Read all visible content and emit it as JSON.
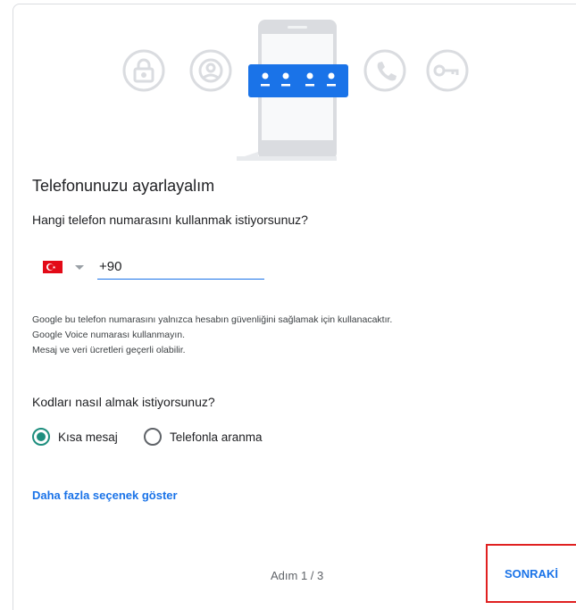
{
  "header": {
    "title": "Telefonunuzu ayarlayalım",
    "question": "Hangi telefon numarasını kullanmak istiyorsunuz?",
    "icons": [
      "lock-icon",
      "account-icon",
      "password-dots-icon",
      "phone-call-icon",
      "key-icon"
    ]
  },
  "phone": {
    "country": "TR",
    "value": "+90"
  },
  "notes": {
    "line1": "Google bu telefon numarasını yalnızca hesabın güvenliğini sağlamak için kullanacaktır.",
    "line2": "Google Voice numarası kullanmayın.",
    "line3": "Mesaj ve veri ücretleri geçerli olabilir."
  },
  "codes": {
    "question": "Kodları nasıl almak istiyorsunuz?",
    "option_sms": "Kısa mesaj",
    "option_call": "Telefonla aranma",
    "selected": "sms"
  },
  "more_options": "Daha fazla seçenek göster",
  "footer": {
    "step": "Adım 1 / 3",
    "next": "SONRAKİ"
  },
  "colors": {
    "accent": "#1a73e8",
    "radio": "#1e8e7e",
    "highlight": "#e02020",
    "flag_red": "#e30a17"
  }
}
